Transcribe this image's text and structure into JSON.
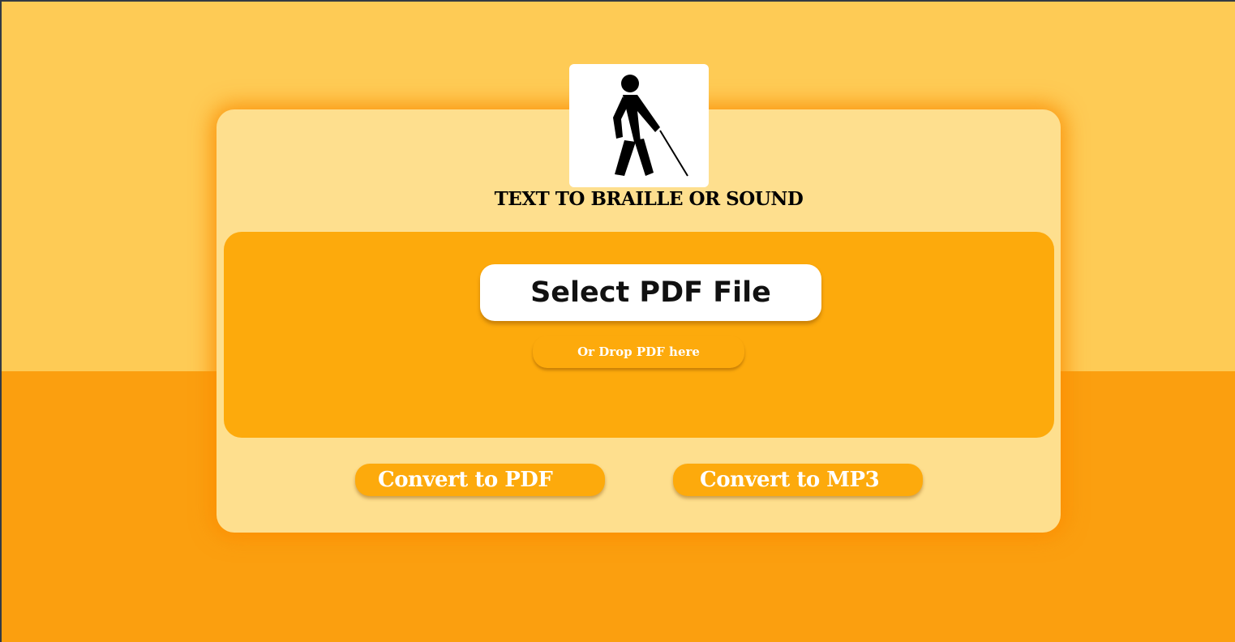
{
  "header": {
    "logo_icon": "blind-person-with-cane-icon",
    "title": "TEXT TO BRAILLE OR SOUND"
  },
  "upload": {
    "select_label": "Select PDF File",
    "drop_hint": "Or Drop PDF here"
  },
  "actions": {
    "convert_pdf_label": "Convert to PDF",
    "convert_mp3_label": "Convert to MP3"
  },
  "colors": {
    "top_background": "#fecb55",
    "bottom_background": "#fb9f0f",
    "card": "#fedf8e",
    "accent": "#fdaa0c",
    "button_text": "#ffffff"
  }
}
